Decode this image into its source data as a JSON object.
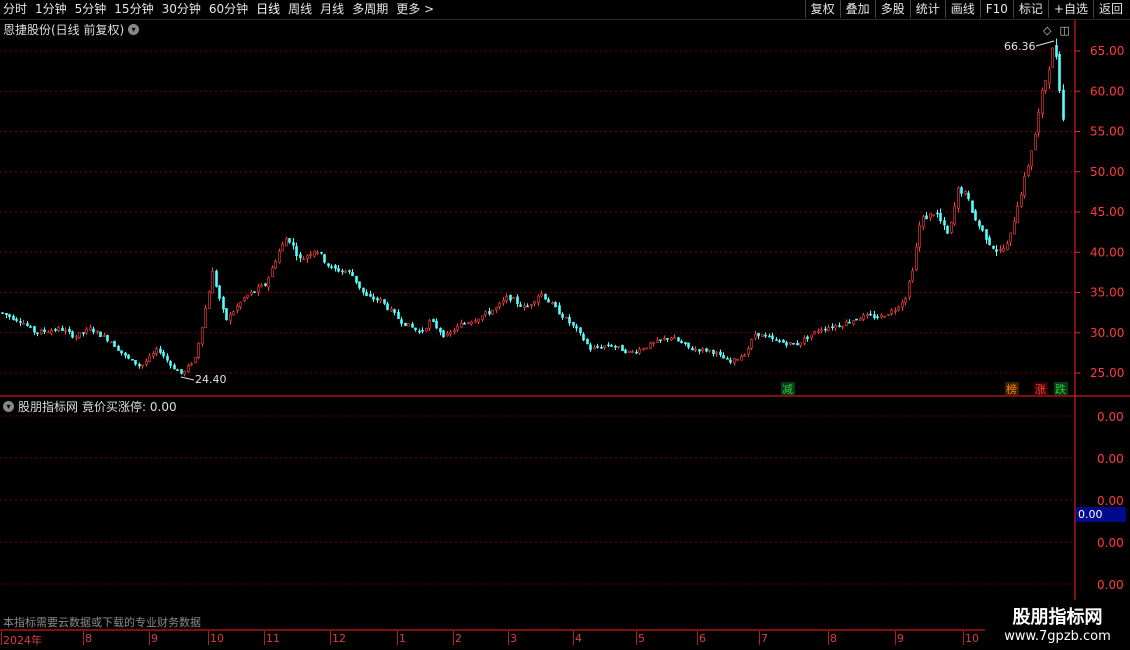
{
  "toolbar": {
    "periods": [
      "分时",
      "1分钟",
      "5分钟",
      "15分钟",
      "30分钟",
      "60分钟",
      "日线",
      "周线",
      "月线",
      "多周期",
      "更多 >"
    ],
    "active_period": "日线",
    "buttons": [
      "复权",
      "叠加",
      "多股",
      "统计",
      "画线",
      "F10",
      "标记",
      "+自选",
      "返回"
    ]
  },
  "main_chart": {
    "title": "恩捷股份(日线 前复权)",
    "price_labels": [
      "65.00",
      "60.00",
      "55.00",
      "50.00",
      "45.00",
      "40.00",
      "35.00",
      "30.00",
      "25.00"
    ],
    "high_label": "66.36",
    "low_label": "24.40",
    "markers": [
      {
        "text": "减",
        "color": "#22cc44"
      },
      {
        "text": "榜",
        "color": "#ff8800"
      },
      {
        "text": "涨",
        "color": "#ff4444"
      },
      {
        "text": "跌",
        "color": "#22cc44"
      }
    ]
  },
  "indicator": {
    "title": "股朋指标网",
    "label": "竟价买涨停: 0.00",
    "axis_labels": [
      "0.00",
      "0.00",
      "0.00",
      "0.00",
      "0.00"
    ],
    "current_value": "0.00"
  },
  "note": "本指标需要云数据或下载的专业财务数据",
  "date_axis": [
    "2024年",
    "8",
    "9",
    "10",
    "11",
    "12",
    "1",
    "2",
    "3",
    "4",
    "5",
    "6",
    "7",
    "8",
    "9",
    "10"
  ],
  "watermark": {
    "title": "股朋指标网",
    "url": "www.7gpzb.com"
  },
  "colors": {
    "up": "#ff3b3b",
    "down": "#54ffff",
    "grid": "#8b0000",
    "axis": "#ff2020"
  }
}
